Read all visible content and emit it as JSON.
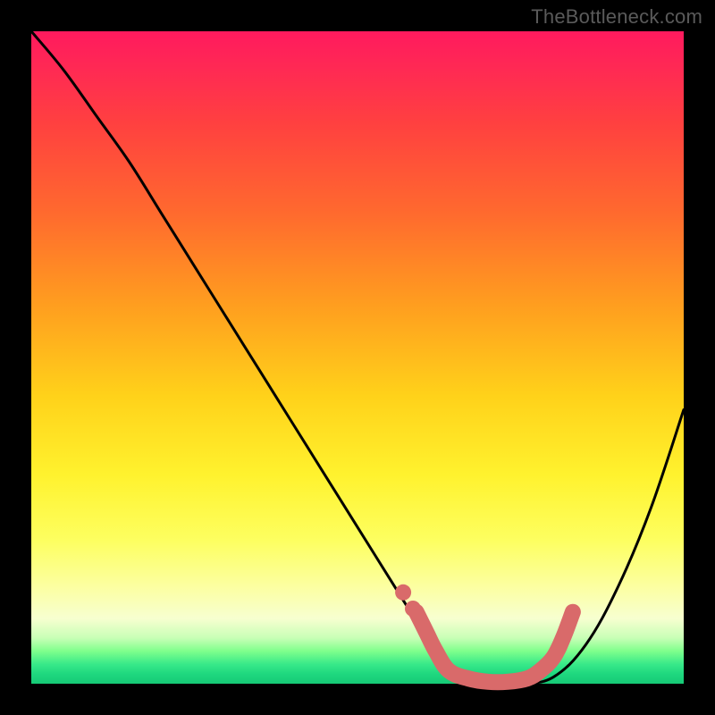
{
  "watermark": "TheBottleneck.com",
  "colors": {
    "page_bg": "#000000",
    "curve": "#000000",
    "highlight": "#d96a6a"
  },
  "chart_data": {
    "type": "line",
    "title": "",
    "xlabel": "",
    "ylabel": "",
    "xlim": [
      0,
      100
    ],
    "ylim": [
      0,
      100
    ],
    "grid": false,
    "legend": false,
    "series": [
      {
        "name": "bottleneck-curve",
        "x": [
          0,
          5,
          10,
          15,
          20,
          25,
          30,
          35,
          40,
          45,
          50,
          55,
          60,
          63,
          66,
          70,
          75,
          80,
          85,
          90,
          95,
          100
        ],
        "y": [
          100,
          94,
          87,
          80,
          72,
          64,
          56,
          48,
          40,
          32,
          24,
          16,
          8,
          3,
          1,
          0,
          0,
          1,
          6,
          15,
          27,
          42
        ]
      },
      {
        "name": "optimal-range-highlight",
        "x": [
          59,
          60.5,
          62,
          64,
          67,
          70,
          73,
          76,
          78,
          80,
          81.5,
          83
        ],
        "y": [
          11,
          8,
          5,
          2,
          0.8,
          0.3,
          0.3,
          0.8,
          2,
          4,
          7,
          11
        ]
      }
    ]
  }
}
